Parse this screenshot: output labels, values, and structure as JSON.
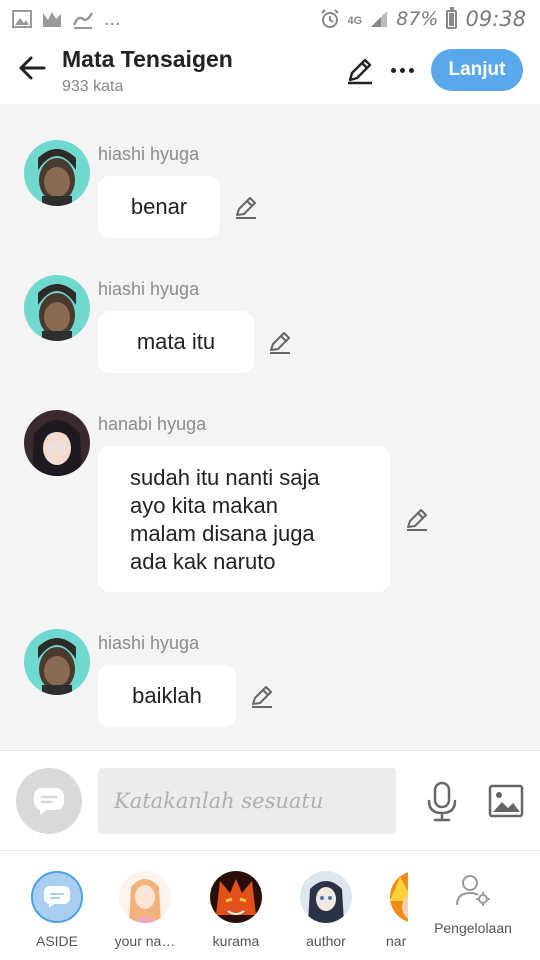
{
  "status_bar": {
    "network": "4G",
    "battery": "87%",
    "time": "09:38",
    "dots": "..."
  },
  "header": {
    "title": "Mata Tensaigen",
    "word_count": "933 kata",
    "next_label": "Lanjut"
  },
  "messages": [
    {
      "sender": "hiashi hyuga",
      "text": "benar",
      "avatar": "hiashi"
    },
    {
      "sender": "hiashi hyuga",
      "text": "mata itu",
      "avatar": "hiashi"
    },
    {
      "sender": "hanabi hyuga",
      "text": "sudah itu nanti saja\nayo  kita makan\nmalam disana juga\nada kak naruto",
      "avatar": "hanabi"
    },
    {
      "sender": "hiashi hyuga",
      "text": "baiklah",
      "avatar": "hiashi"
    }
  ],
  "composer": {
    "placeholder": "Katakanlah sesuatu"
  },
  "characters": [
    {
      "label": "ASIDE"
    },
    {
      "label": "your na…"
    },
    {
      "label": "kurama"
    },
    {
      "label": "author"
    },
    {
      "label": "nar"
    }
  ],
  "management_label": "Pengelolaan",
  "colors": {
    "accent": "#5aa8ec",
    "background": "#f4f4f4",
    "bubble": "#ffffff"
  }
}
